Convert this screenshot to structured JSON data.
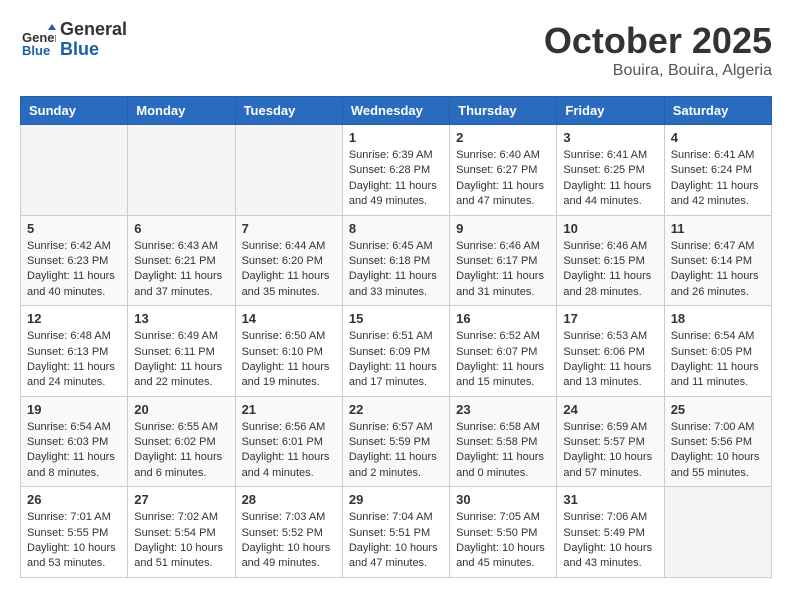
{
  "header": {
    "logo_line1": "General",
    "logo_line2": "Blue",
    "month": "October 2025",
    "location": "Bouira, Bouira, Algeria"
  },
  "weekdays": [
    "Sunday",
    "Monday",
    "Tuesday",
    "Wednesday",
    "Thursday",
    "Friday",
    "Saturday"
  ],
  "weeks": [
    [
      {
        "day": "",
        "text": ""
      },
      {
        "day": "",
        "text": ""
      },
      {
        "day": "",
        "text": ""
      },
      {
        "day": "1",
        "text": "Sunrise: 6:39 AM\nSunset: 6:28 PM\nDaylight: 11 hours and 49 minutes."
      },
      {
        "day": "2",
        "text": "Sunrise: 6:40 AM\nSunset: 6:27 PM\nDaylight: 11 hours and 47 minutes."
      },
      {
        "day": "3",
        "text": "Sunrise: 6:41 AM\nSunset: 6:25 PM\nDaylight: 11 hours and 44 minutes."
      },
      {
        "day": "4",
        "text": "Sunrise: 6:41 AM\nSunset: 6:24 PM\nDaylight: 11 hours and 42 minutes."
      }
    ],
    [
      {
        "day": "5",
        "text": "Sunrise: 6:42 AM\nSunset: 6:23 PM\nDaylight: 11 hours and 40 minutes."
      },
      {
        "day": "6",
        "text": "Sunrise: 6:43 AM\nSunset: 6:21 PM\nDaylight: 11 hours and 37 minutes."
      },
      {
        "day": "7",
        "text": "Sunrise: 6:44 AM\nSunset: 6:20 PM\nDaylight: 11 hours and 35 minutes."
      },
      {
        "day": "8",
        "text": "Sunrise: 6:45 AM\nSunset: 6:18 PM\nDaylight: 11 hours and 33 minutes."
      },
      {
        "day": "9",
        "text": "Sunrise: 6:46 AM\nSunset: 6:17 PM\nDaylight: 11 hours and 31 minutes."
      },
      {
        "day": "10",
        "text": "Sunrise: 6:46 AM\nSunset: 6:15 PM\nDaylight: 11 hours and 28 minutes."
      },
      {
        "day": "11",
        "text": "Sunrise: 6:47 AM\nSunset: 6:14 PM\nDaylight: 11 hours and 26 minutes."
      }
    ],
    [
      {
        "day": "12",
        "text": "Sunrise: 6:48 AM\nSunset: 6:13 PM\nDaylight: 11 hours and 24 minutes."
      },
      {
        "day": "13",
        "text": "Sunrise: 6:49 AM\nSunset: 6:11 PM\nDaylight: 11 hours and 22 minutes."
      },
      {
        "day": "14",
        "text": "Sunrise: 6:50 AM\nSunset: 6:10 PM\nDaylight: 11 hours and 19 minutes."
      },
      {
        "day": "15",
        "text": "Sunrise: 6:51 AM\nSunset: 6:09 PM\nDaylight: 11 hours and 17 minutes."
      },
      {
        "day": "16",
        "text": "Sunrise: 6:52 AM\nSunset: 6:07 PM\nDaylight: 11 hours and 15 minutes."
      },
      {
        "day": "17",
        "text": "Sunrise: 6:53 AM\nSunset: 6:06 PM\nDaylight: 11 hours and 13 minutes."
      },
      {
        "day": "18",
        "text": "Sunrise: 6:54 AM\nSunset: 6:05 PM\nDaylight: 11 hours and 11 minutes."
      }
    ],
    [
      {
        "day": "19",
        "text": "Sunrise: 6:54 AM\nSunset: 6:03 PM\nDaylight: 11 hours and 8 minutes."
      },
      {
        "day": "20",
        "text": "Sunrise: 6:55 AM\nSunset: 6:02 PM\nDaylight: 11 hours and 6 minutes."
      },
      {
        "day": "21",
        "text": "Sunrise: 6:56 AM\nSunset: 6:01 PM\nDaylight: 11 hours and 4 minutes."
      },
      {
        "day": "22",
        "text": "Sunrise: 6:57 AM\nSunset: 5:59 PM\nDaylight: 11 hours and 2 minutes."
      },
      {
        "day": "23",
        "text": "Sunrise: 6:58 AM\nSunset: 5:58 PM\nDaylight: 11 hours and 0 minutes."
      },
      {
        "day": "24",
        "text": "Sunrise: 6:59 AM\nSunset: 5:57 PM\nDaylight: 10 hours and 57 minutes."
      },
      {
        "day": "25",
        "text": "Sunrise: 7:00 AM\nSunset: 5:56 PM\nDaylight: 10 hours and 55 minutes."
      }
    ],
    [
      {
        "day": "26",
        "text": "Sunrise: 7:01 AM\nSunset: 5:55 PM\nDaylight: 10 hours and 53 minutes."
      },
      {
        "day": "27",
        "text": "Sunrise: 7:02 AM\nSunset: 5:54 PM\nDaylight: 10 hours and 51 minutes."
      },
      {
        "day": "28",
        "text": "Sunrise: 7:03 AM\nSunset: 5:52 PM\nDaylight: 10 hours and 49 minutes."
      },
      {
        "day": "29",
        "text": "Sunrise: 7:04 AM\nSunset: 5:51 PM\nDaylight: 10 hours and 47 minutes."
      },
      {
        "day": "30",
        "text": "Sunrise: 7:05 AM\nSunset: 5:50 PM\nDaylight: 10 hours and 45 minutes."
      },
      {
        "day": "31",
        "text": "Sunrise: 7:06 AM\nSunset: 5:49 PM\nDaylight: 10 hours and 43 minutes."
      },
      {
        "day": "",
        "text": ""
      }
    ]
  ]
}
